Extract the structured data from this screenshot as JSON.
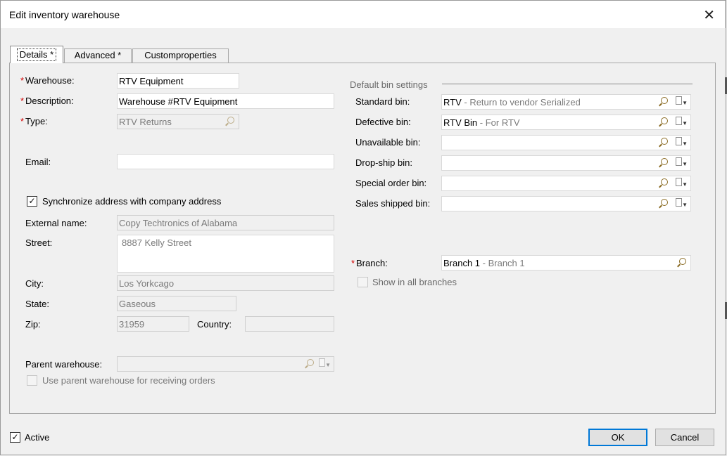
{
  "window": {
    "title": "Edit inventory warehouse"
  },
  "tabs": [
    "Details *",
    "Advanced *",
    "Customproperties"
  ],
  "details": {
    "warehouse_label": "Warehouse:",
    "warehouse_value": "RTV Equipment",
    "description_label": "Description:",
    "description_value": "Warehouse #RTV Equipment",
    "type_label": "Type:",
    "type_value": "RTV Returns",
    "email_label": "Email:",
    "email_value": "",
    "sync_label": "Synchronize address with company address",
    "sync_checked": true,
    "external_name_label": "External name:",
    "external_name_value": "Copy Techtronics of Alabama",
    "street_label": "Street:",
    "street_value": "8887 Kelly Street",
    "city_label": "City:",
    "city_value": "Los Yorkcago",
    "state_label": "State:",
    "state_value": "Gaseous",
    "zip_label": "Zip:",
    "zip_value": "31959",
    "country_label": "Country:",
    "country_value": "",
    "parent_label": "Parent warehouse:",
    "parent_value": "",
    "use_parent_label": "Use parent warehouse for receiving orders"
  },
  "bins": {
    "section_label": "Default bin settings",
    "items": [
      {
        "label": "Standard bin:",
        "code": "RTV",
        "desc": " - Return to vendor Serialized"
      },
      {
        "label": "Defective bin:",
        "code": "RTV Bin",
        "desc": " - For RTV"
      },
      {
        "label": "Unavailable bin:",
        "code": "",
        "desc": ""
      },
      {
        "label": "Drop-ship bin:",
        "code": "",
        "desc": ""
      },
      {
        "label": "Special order bin:",
        "code": "",
        "desc": ""
      },
      {
        "label": "Sales shipped bin:",
        "code": "",
        "desc": ""
      }
    ]
  },
  "branch": {
    "label": "Branch:",
    "code": "Branch 1",
    "desc": " - Branch 1",
    "show_all_label": "Show in all branches"
  },
  "footer": {
    "active_label": "Active",
    "ok_label": "OK",
    "cancel_label": "Cancel"
  },
  "icons": [
    "close-icon",
    "search-icon",
    "document-icon",
    "dropdown-arrow-icon",
    "checkmark-icon"
  ],
  "colors": {
    "required": "#d40000",
    "primary_border": "#0078d7"
  }
}
